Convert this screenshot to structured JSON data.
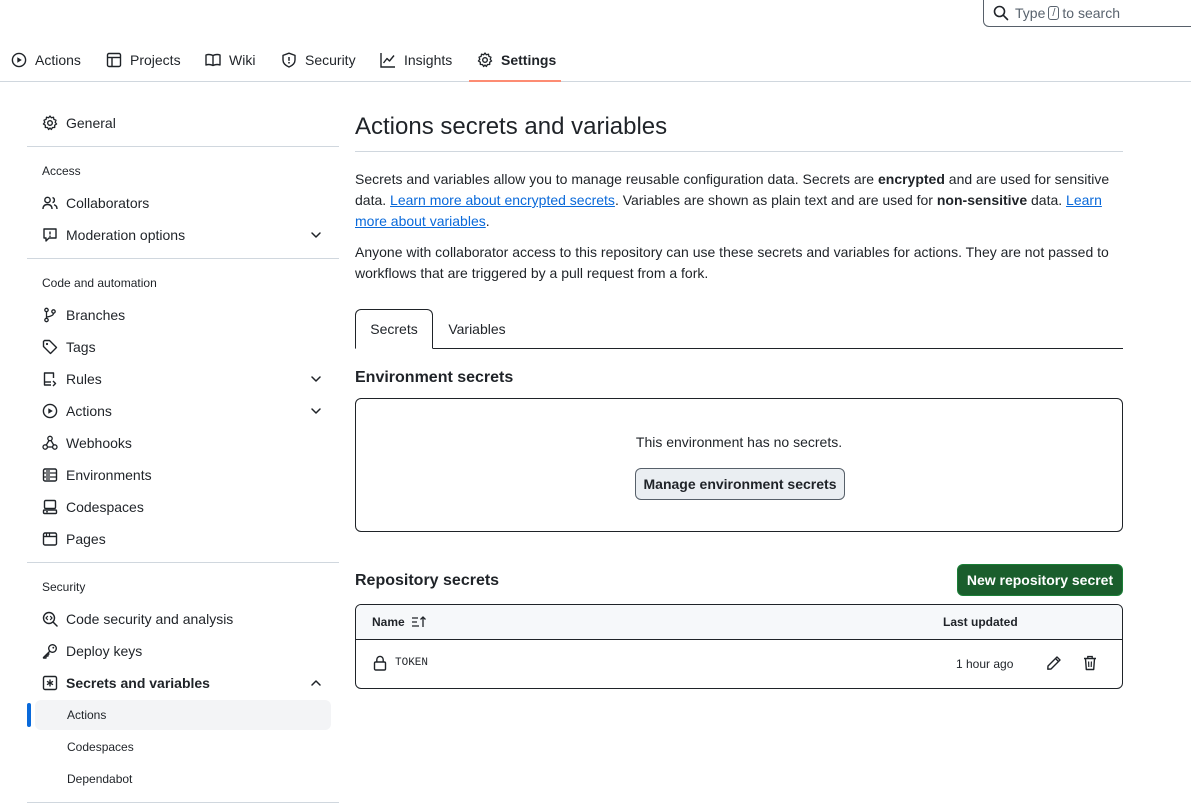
{
  "search": {
    "prefix": "Type",
    "key": "/",
    "suffix": "to search"
  },
  "repo_nav": {
    "items": [
      {
        "label": "Actions",
        "icon": "play-icon"
      },
      {
        "label": "Projects",
        "icon": "table-icon"
      },
      {
        "label": "Wiki",
        "icon": "book-icon"
      },
      {
        "label": "Security",
        "icon": "shield-icon"
      },
      {
        "label": "Insights",
        "icon": "graph-icon"
      },
      {
        "label": "Settings",
        "icon": "gear-icon",
        "selected": true
      }
    ],
    "selected_underline_color": "#fd8c73"
  },
  "sidebar": {
    "general": "General",
    "access_heading": "Access",
    "collaborators": "Collaborators",
    "moderation": "Moderation options",
    "code_heading": "Code and automation",
    "branches": "Branches",
    "tags": "Tags",
    "rules": "Rules",
    "actions": "Actions",
    "webhooks": "Webhooks",
    "environments": "Environments",
    "codespaces": "Codespaces",
    "pages": "Pages",
    "security_heading": "Security",
    "code_security": "Code security and analysis",
    "deploy_keys": "Deploy keys",
    "secrets_vars": "Secrets and variables",
    "sub_actions": "Actions",
    "sub_codespaces": "Codespaces",
    "sub_dependabot": "Dependabot",
    "active_color": "#0969da"
  },
  "main": {
    "title": "Actions secrets and variables",
    "intro": {
      "t1": "Secrets and variables allow you to manage reusable configuration data. Secrets are ",
      "b1": "encrypted",
      "t2": " and are used for sensitive data. ",
      "link1": "Learn more about encrypted secrets",
      "t3": ". Variables are shown as plain text and are used for ",
      "b2": "non-sensitive",
      "t4": " data. ",
      "link2": "Learn more about variables",
      "t5": "."
    },
    "note": "Anyone with collaborator access to this repository can use these secrets and variables for actions. They are not passed to workflows that are triggered by a pull request from a fork.",
    "tabs": [
      "Secrets",
      "Variables"
    ],
    "env_title": "Environment secrets",
    "env_empty": "This environment has no secrets.",
    "env_button": "Manage environment secrets",
    "repo_title": "Repository secrets",
    "new_button": "New repository secret",
    "table": {
      "col_name": "Name",
      "col_updated": "Last updated",
      "rows": [
        {
          "name": "TOKEN",
          "updated": "1 hour ago"
        }
      ]
    },
    "primary_color": "#1a5e2c",
    "link_color": "#0969da"
  }
}
